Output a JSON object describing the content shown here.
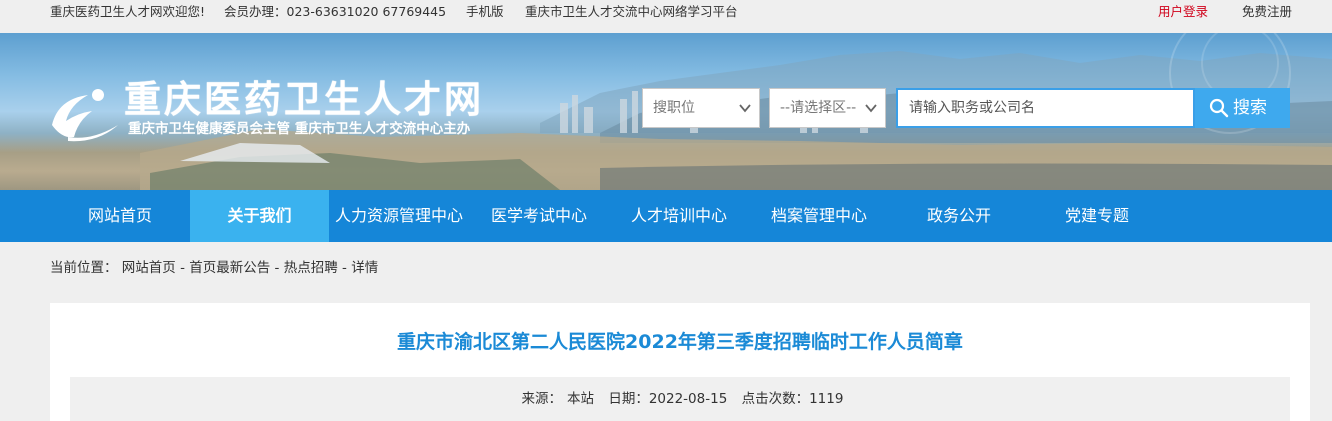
{
  "topbar": {
    "welcome": "重庆医药卫生人才网欢迎您!",
    "member": "会员办理：023-63631020 67769445",
    "mobile": "手机版",
    "platform": "重庆市卫生人才交流中心网络学习平台",
    "login": "用户登录",
    "register": "免费注册"
  },
  "header": {
    "site_title": "重庆医药卫生人才网",
    "sponsor": "重庆市卫生健康委员会主管  重庆市卫生人才交流中心主办"
  },
  "search": {
    "job_select": "搜职位",
    "area_select": "--请选择区--",
    "placeholder": "请输入职务或公司名",
    "button": "搜索"
  },
  "nav": {
    "items": [
      {
        "label": "网站首页"
      },
      {
        "label": "关于我们"
      },
      {
        "label": "人力资源管理中心"
      },
      {
        "label": "医学考试中心"
      },
      {
        "label": "人才培训中心"
      },
      {
        "label": "档案管理中心"
      },
      {
        "label": "政务公开"
      },
      {
        "label": "党建专题"
      }
    ],
    "active_index": 1
  },
  "breadcrumb": {
    "prefix": "当前位置：",
    "items": [
      "网站首页",
      "首页最新公告",
      "热点招聘",
      "详情"
    ],
    "separator": " - "
  },
  "article": {
    "title": "重庆市渝北区第二人民医院2022年第三季度招聘临时工作人员简章",
    "source_label": "来源：",
    "source": "本站",
    "date_label": "日期：",
    "date": "2022-08-15",
    "clicks_label": "点击次数：",
    "clicks": "1119"
  },
  "colors": {
    "nav_bg": "#1586d8",
    "nav_active": "#3ab2ef",
    "title_blue": "#1b8ad6",
    "login_red": "#d0021b",
    "search_btn": "#3ea9ee"
  }
}
